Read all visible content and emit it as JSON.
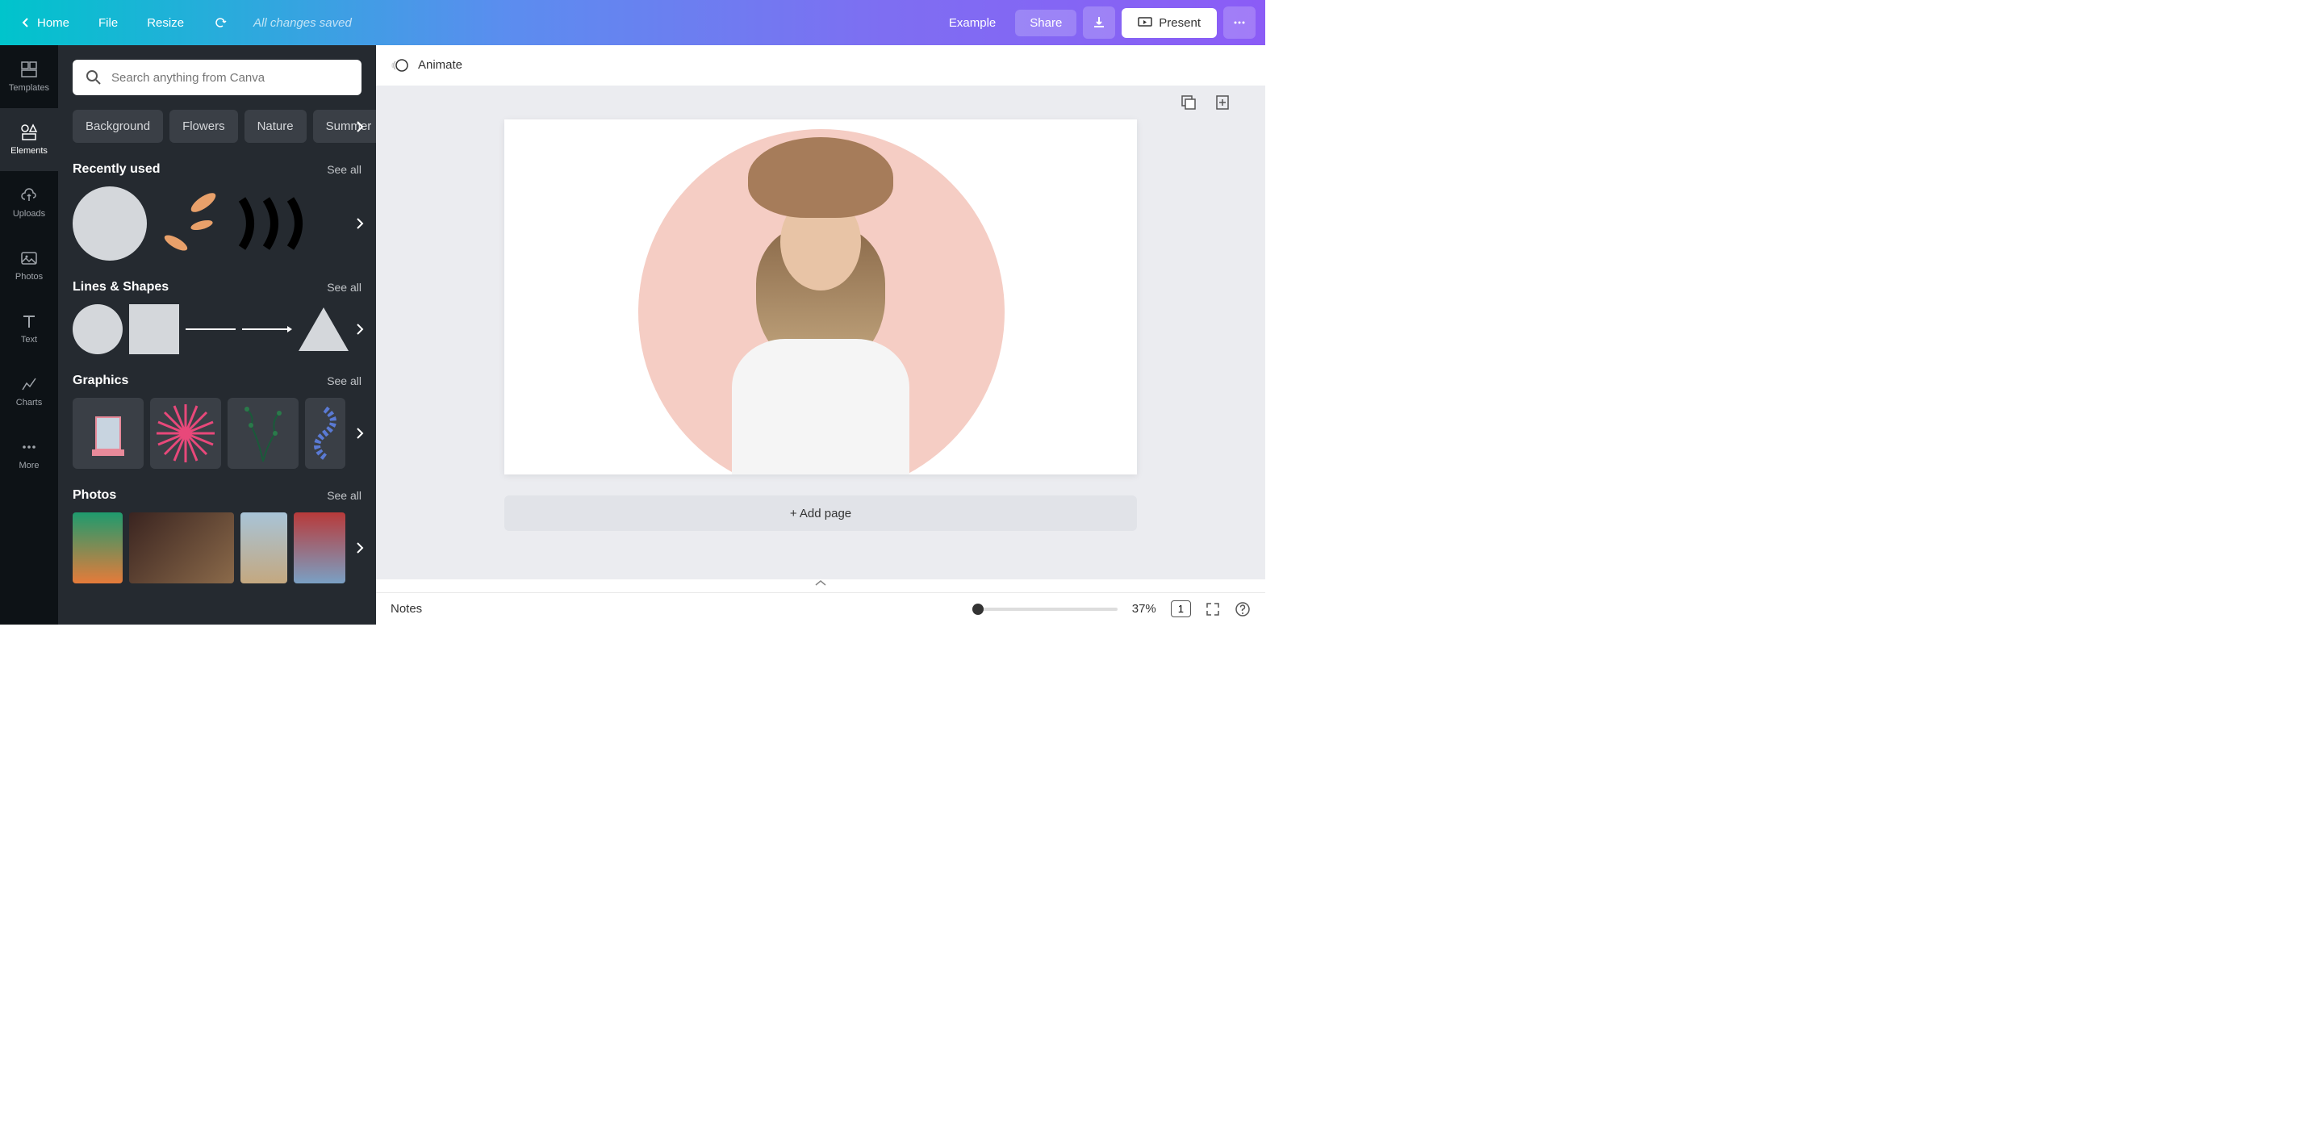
{
  "header": {
    "home_label": "Home",
    "file_label": "File",
    "resize_label": "Resize",
    "saved_status": "All changes saved",
    "doc_name": "Example",
    "share_label": "Share",
    "present_label": "Present"
  },
  "rail": {
    "items": [
      {
        "label": "Templates",
        "icon": "templates-icon"
      },
      {
        "label": "Elements",
        "icon": "elements-icon"
      },
      {
        "label": "Uploads",
        "icon": "uploads-icon"
      },
      {
        "label": "Photos",
        "icon": "photos-icon"
      },
      {
        "label": "Text",
        "icon": "text-icon"
      },
      {
        "label": "Charts",
        "icon": "charts-icon"
      },
      {
        "label": "More",
        "icon": "more-icon"
      }
    ],
    "active_index": 1
  },
  "panel": {
    "search_placeholder": "Search anything from Canva",
    "chips": [
      "Background",
      "Flowers",
      "Nature",
      "Summer"
    ],
    "sections": {
      "recently_used": {
        "title": "Recently used",
        "see_all": "See all"
      },
      "lines_shapes": {
        "title": "Lines & Shapes",
        "see_all": "See all"
      },
      "graphics": {
        "title": "Graphics",
        "see_all": "See all"
      },
      "photos": {
        "title": "Photos",
        "see_all": "See all"
      }
    }
  },
  "canvas": {
    "animate_label": "Animate",
    "add_page_label": "+ Add page",
    "accent_color": "#f5cdc4"
  },
  "footer": {
    "notes_label": "Notes",
    "zoom_level": "37%",
    "page_count": "1"
  }
}
